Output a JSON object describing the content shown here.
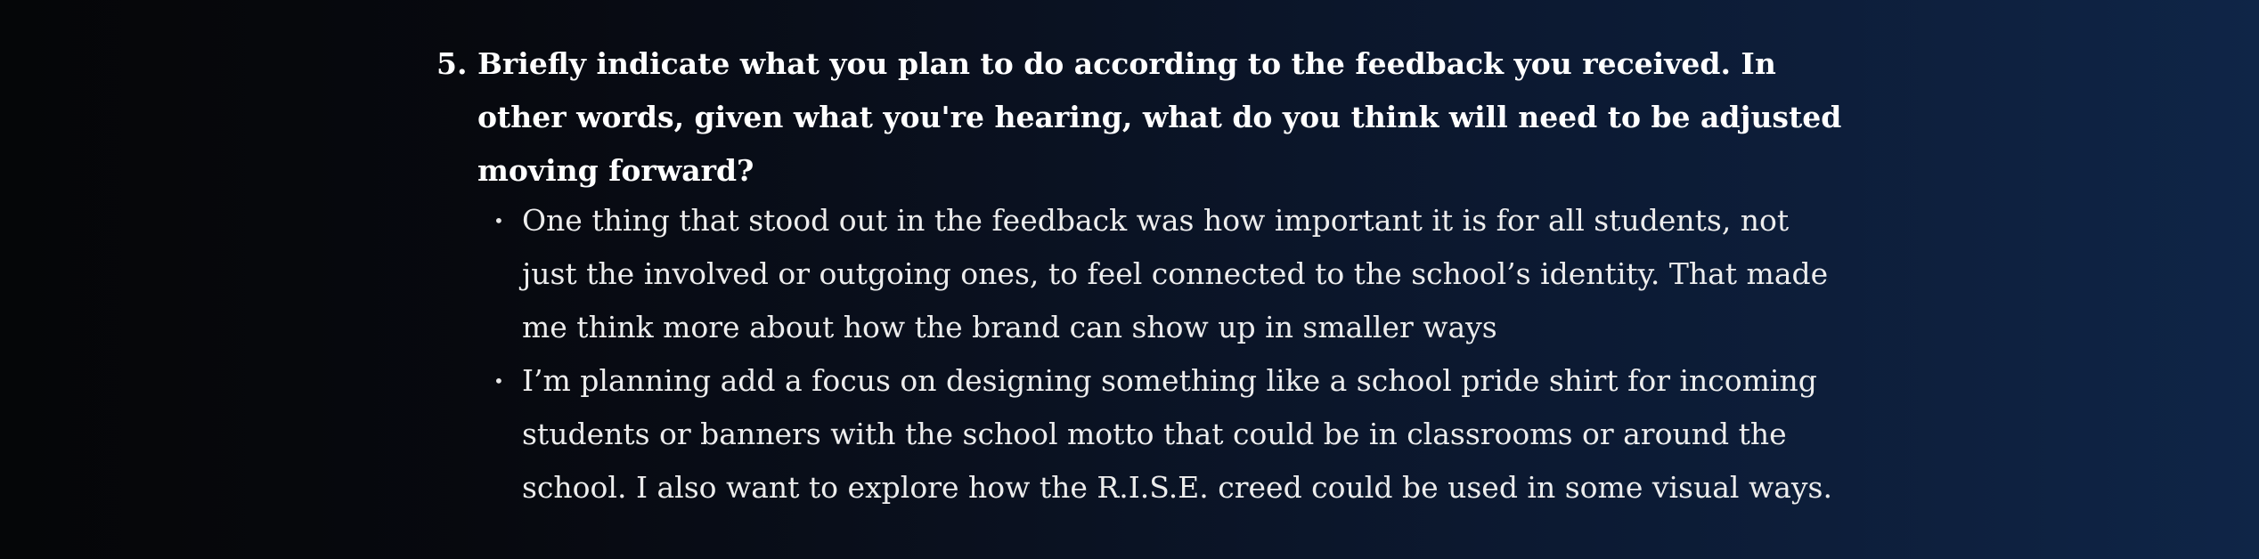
{
  "question": {
    "number": "5.",
    "text": "Briefly indicate what you plan to do according to the feedback you received. In other words, given what you're hearing, what do you think will need to be adjusted moving forward?"
  },
  "answers": [
    {
      "bullet": "•",
      "text": "One thing that stood out in the feedback was how important it is for all students, not just the involved or outgoing ones, to feel connected to the school’s identity. That made me think more about how the brand can show up in smaller ways"
    },
    {
      "bullet": "•",
      "text": "I’m planning add a focus on designing something like a school pride shirt for incoming students or banners with the school motto that could be in classrooms or around the school. I also want to explore how the R.I.S.E. creed could be used in some visual ways."
    }
  ]
}
